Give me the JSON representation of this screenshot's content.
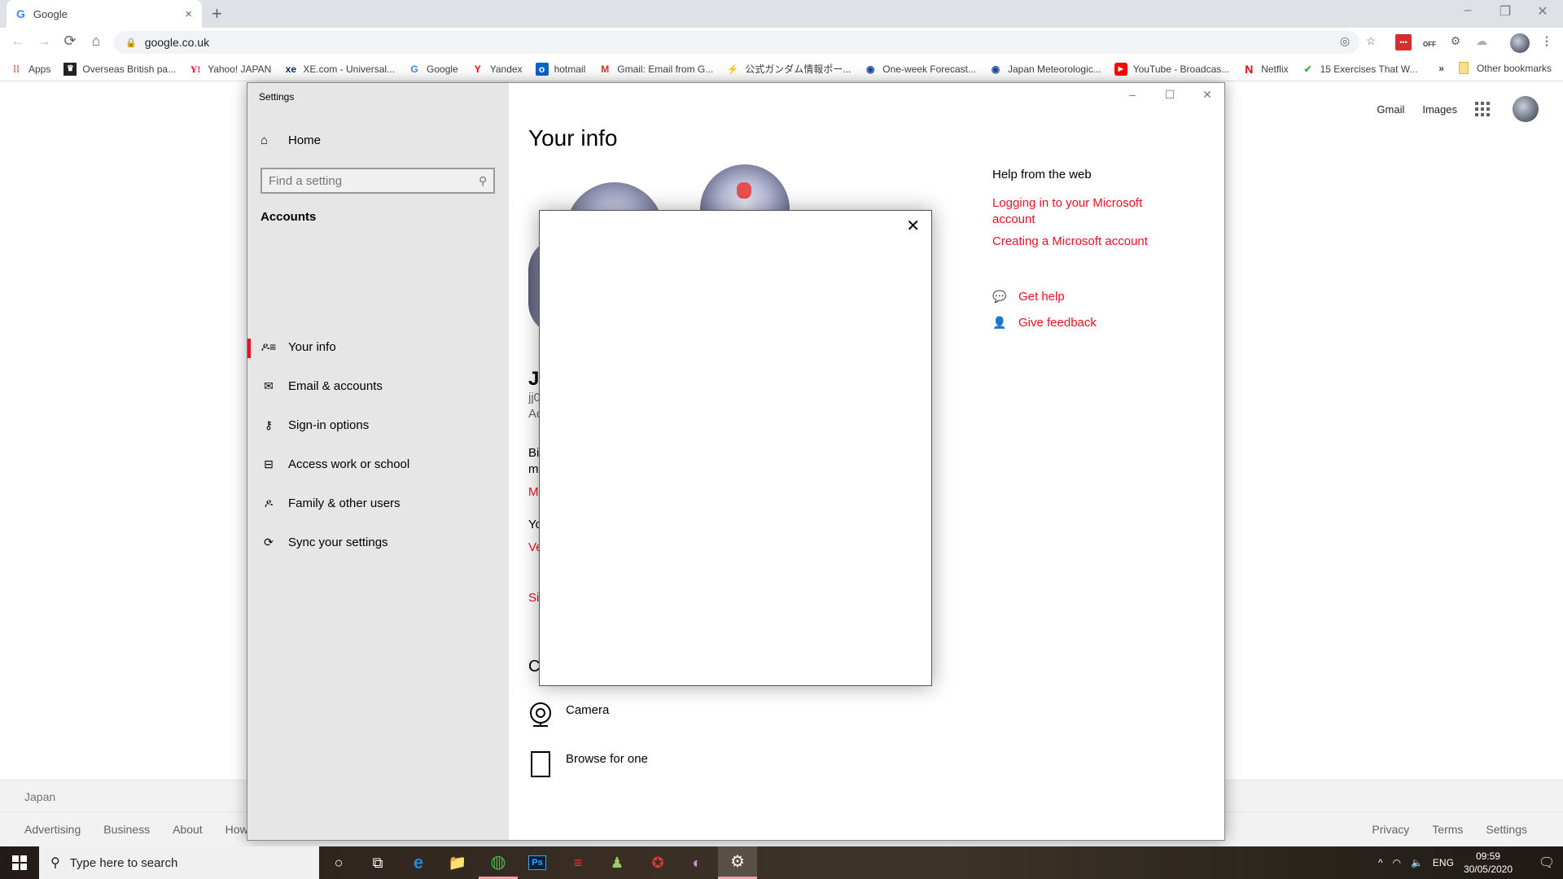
{
  "browser": {
    "tab_title": "Google",
    "tab_icon": "google-g-icon",
    "new_tab": "+",
    "tab_close": "×",
    "window_controls": {
      "minimize": "–",
      "restore": "❐",
      "close": "✕"
    },
    "nav": {
      "back": "←",
      "forward": "→",
      "reload": "⟳",
      "home": "⌂"
    },
    "url": "google.co.uk",
    "toolbar_icons": [
      "location-icon",
      "star-icon",
      "lastpass-icon",
      "off-extension-icon",
      "gear-extension-icon",
      "cloud-extension-icon",
      "profile-avatar",
      "menu-icon"
    ],
    "bookmarks": [
      {
        "label": "Apps",
        "icon": "apps-grid-icon",
        "glyph": "⋮⋮",
        "color": "#e8453c"
      },
      {
        "label": "Overseas British pa...",
        "icon": "crest-icon",
        "glyph": "♛",
        "color": "#222222"
      },
      {
        "label": "Yahoo! JAPAN",
        "icon": "yahoo-icon",
        "glyph": "Y!",
        "color": "#ff0033"
      },
      {
        "label": "XE.com - Universal...",
        "icon": "xe-icon",
        "glyph": "xe",
        "color": "#0b2f6b"
      },
      {
        "label": "Google",
        "icon": "google-icon",
        "glyph": "G",
        "color": "#4285f4"
      },
      {
        "label": "Yandex",
        "icon": "yandex-icon",
        "glyph": "Y",
        "color": "#ff0000"
      },
      {
        "label": "hotmail",
        "icon": "outlook-icon",
        "glyph": "o",
        "color": "#0a64c8"
      },
      {
        "label": "Gmail: Email from G...",
        "icon": "gmail-icon",
        "glyph": "M",
        "color": "#d93025"
      },
      {
        "label": "公式ガンダム情報ポー...",
        "icon": "gundam-icon",
        "glyph": "⚡",
        "color": "#e8c020"
      },
      {
        "label": "One-week Forecast...",
        "icon": "jma-icon",
        "glyph": "◉",
        "color": "#1d4ba0"
      },
      {
        "label": "Japan Meteorologic...",
        "icon": "jma-icon",
        "glyph": "◉",
        "color": "#1d4ba0"
      },
      {
        "label": "YouTube - Broadcas...",
        "icon": "youtube-icon",
        "glyph": "▶",
        "color": "#ff0000"
      },
      {
        "label": "Netflix",
        "icon": "netflix-icon",
        "glyph": "N",
        "color": "#e50914"
      },
      {
        "label": "15 Exercises That W...",
        "icon": "check-icon",
        "glyph": "✔",
        "color": "#3cb043"
      }
    ],
    "bookmarks_overflow": "»",
    "other_bookmarks": "Other bookmarks"
  },
  "google_page": {
    "header_links": [
      "Gmail",
      "Images"
    ],
    "footer_country": "Japan",
    "footer_left": [
      "Advertising",
      "Business",
      "About",
      "How"
    ],
    "footer_right": [
      "Privacy",
      "Terms",
      "Settings"
    ]
  },
  "settings": {
    "window_title": "Settings",
    "window_controls": {
      "minimize": "–",
      "maximize": "☐",
      "close": "✕"
    },
    "home_label": "Home",
    "search_placeholder": "Find a setting",
    "section_title": "Accounts",
    "nav_items": [
      {
        "label": "Your info",
        "icon": "person-list-icon",
        "glyph": "⚲☰",
        "active": true
      },
      {
        "label": "Email & accounts",
        "icon": "mail-icon",
        "glyph": "✉",
        "active": false
      },
      {
        "label": "Sign-in options",
        "icon": "key-icon",
        "glyph": "⚷",
        "active": false
      },
      {
        "label": "Access work or school",
        "icon": "briefcase-icon",
        "glyph": "💼",
        "active": false
      },
      {
        "label": "Family & other users",
        "icon": "person-add-icon",
        "glyph": "⚲",
        "active": false
      },
      {
        "label": "Sync your settings",
        "icon": "sync-icon",
        "glyph": "⟳",
        "active": false
      }
    ],
    "main": {
      "title": "Your info",
      "name_fragment": "JI",
      "email_fragment": "jj0",
      "account_fragment": "Ac",
      "billing_fragment_1": "Bil",
      "billing_fragment_2": "m",
      "manage_fragment": "M",
      "you_fragment": "Yo",
      "verify_fragment": "Ve",
      "sign_fragment": "Sig",
      "create_fragment": "Cr",
      "picture_options": [
        {
          "label": "Camera",
          "icon": "camera-icon"
        },
        {
          "label": "Browse for one",
          "icon": "browse-file-icon"
        }
      ]
    },
    "help": {
      "title": "Help from the web",
      "links": [
        "Logging in to your Microsoft account",
        "Creating a Microsoft account"
      ],
      "actions": [
        {
          "label": "Get help",
          "icon": "get-help-icon",
          "glyph": "🗨"
        },
        {
          "label": "Give feedback",
          "icon": "feedback-icon",
          "glyph": "👤"
        }
      ]
    },
    "accent_color": "#e81123"
  },
  "modal": {
    "close": "✕"
  },
  "taskbar": {
    "search_placeholder": "Type here to search",
    "apps": [
      {
        "name": "cortana-icon",
        "glyph": "○"
      },
      {
        "name": "task-view-icon",
        "glyph": "⧉"
      },
      {
        "name": "edge-icon",
        "glyph": "e"
      },
      {
        "name": "file-explorer-icon",
        "glyph": "📁"
      },
      {
        "name": "chrome-icon",
        "glyph": "◍"
      },
      {
        "name": "photoshop-icon",
        "glyph": "Ps"
      },
      {
        "name": "app-red-stripes-icon",
        "glyph": "≡"
      },
      {
        "name": "app-figure-icon",
        "glyph": "♟"
      },
      {
        "name": "app-red-emblem-icon",
        "glyph": "✪"
      },
      {
        "name": "app-disc-icon",
        "glyph": "◐"
      },
      {
        "name": "settings-icon",
        "glyph": "⚙"
      }
    ],
    "tray": {
      "chevron": "^",
      "wifi": "◠",
      "volume": "🔈",
      "language": "ENG",
      "time": "09:59",
      "date": "30/05/2020",
      "notifications": "🗨"
    }
  }
}
